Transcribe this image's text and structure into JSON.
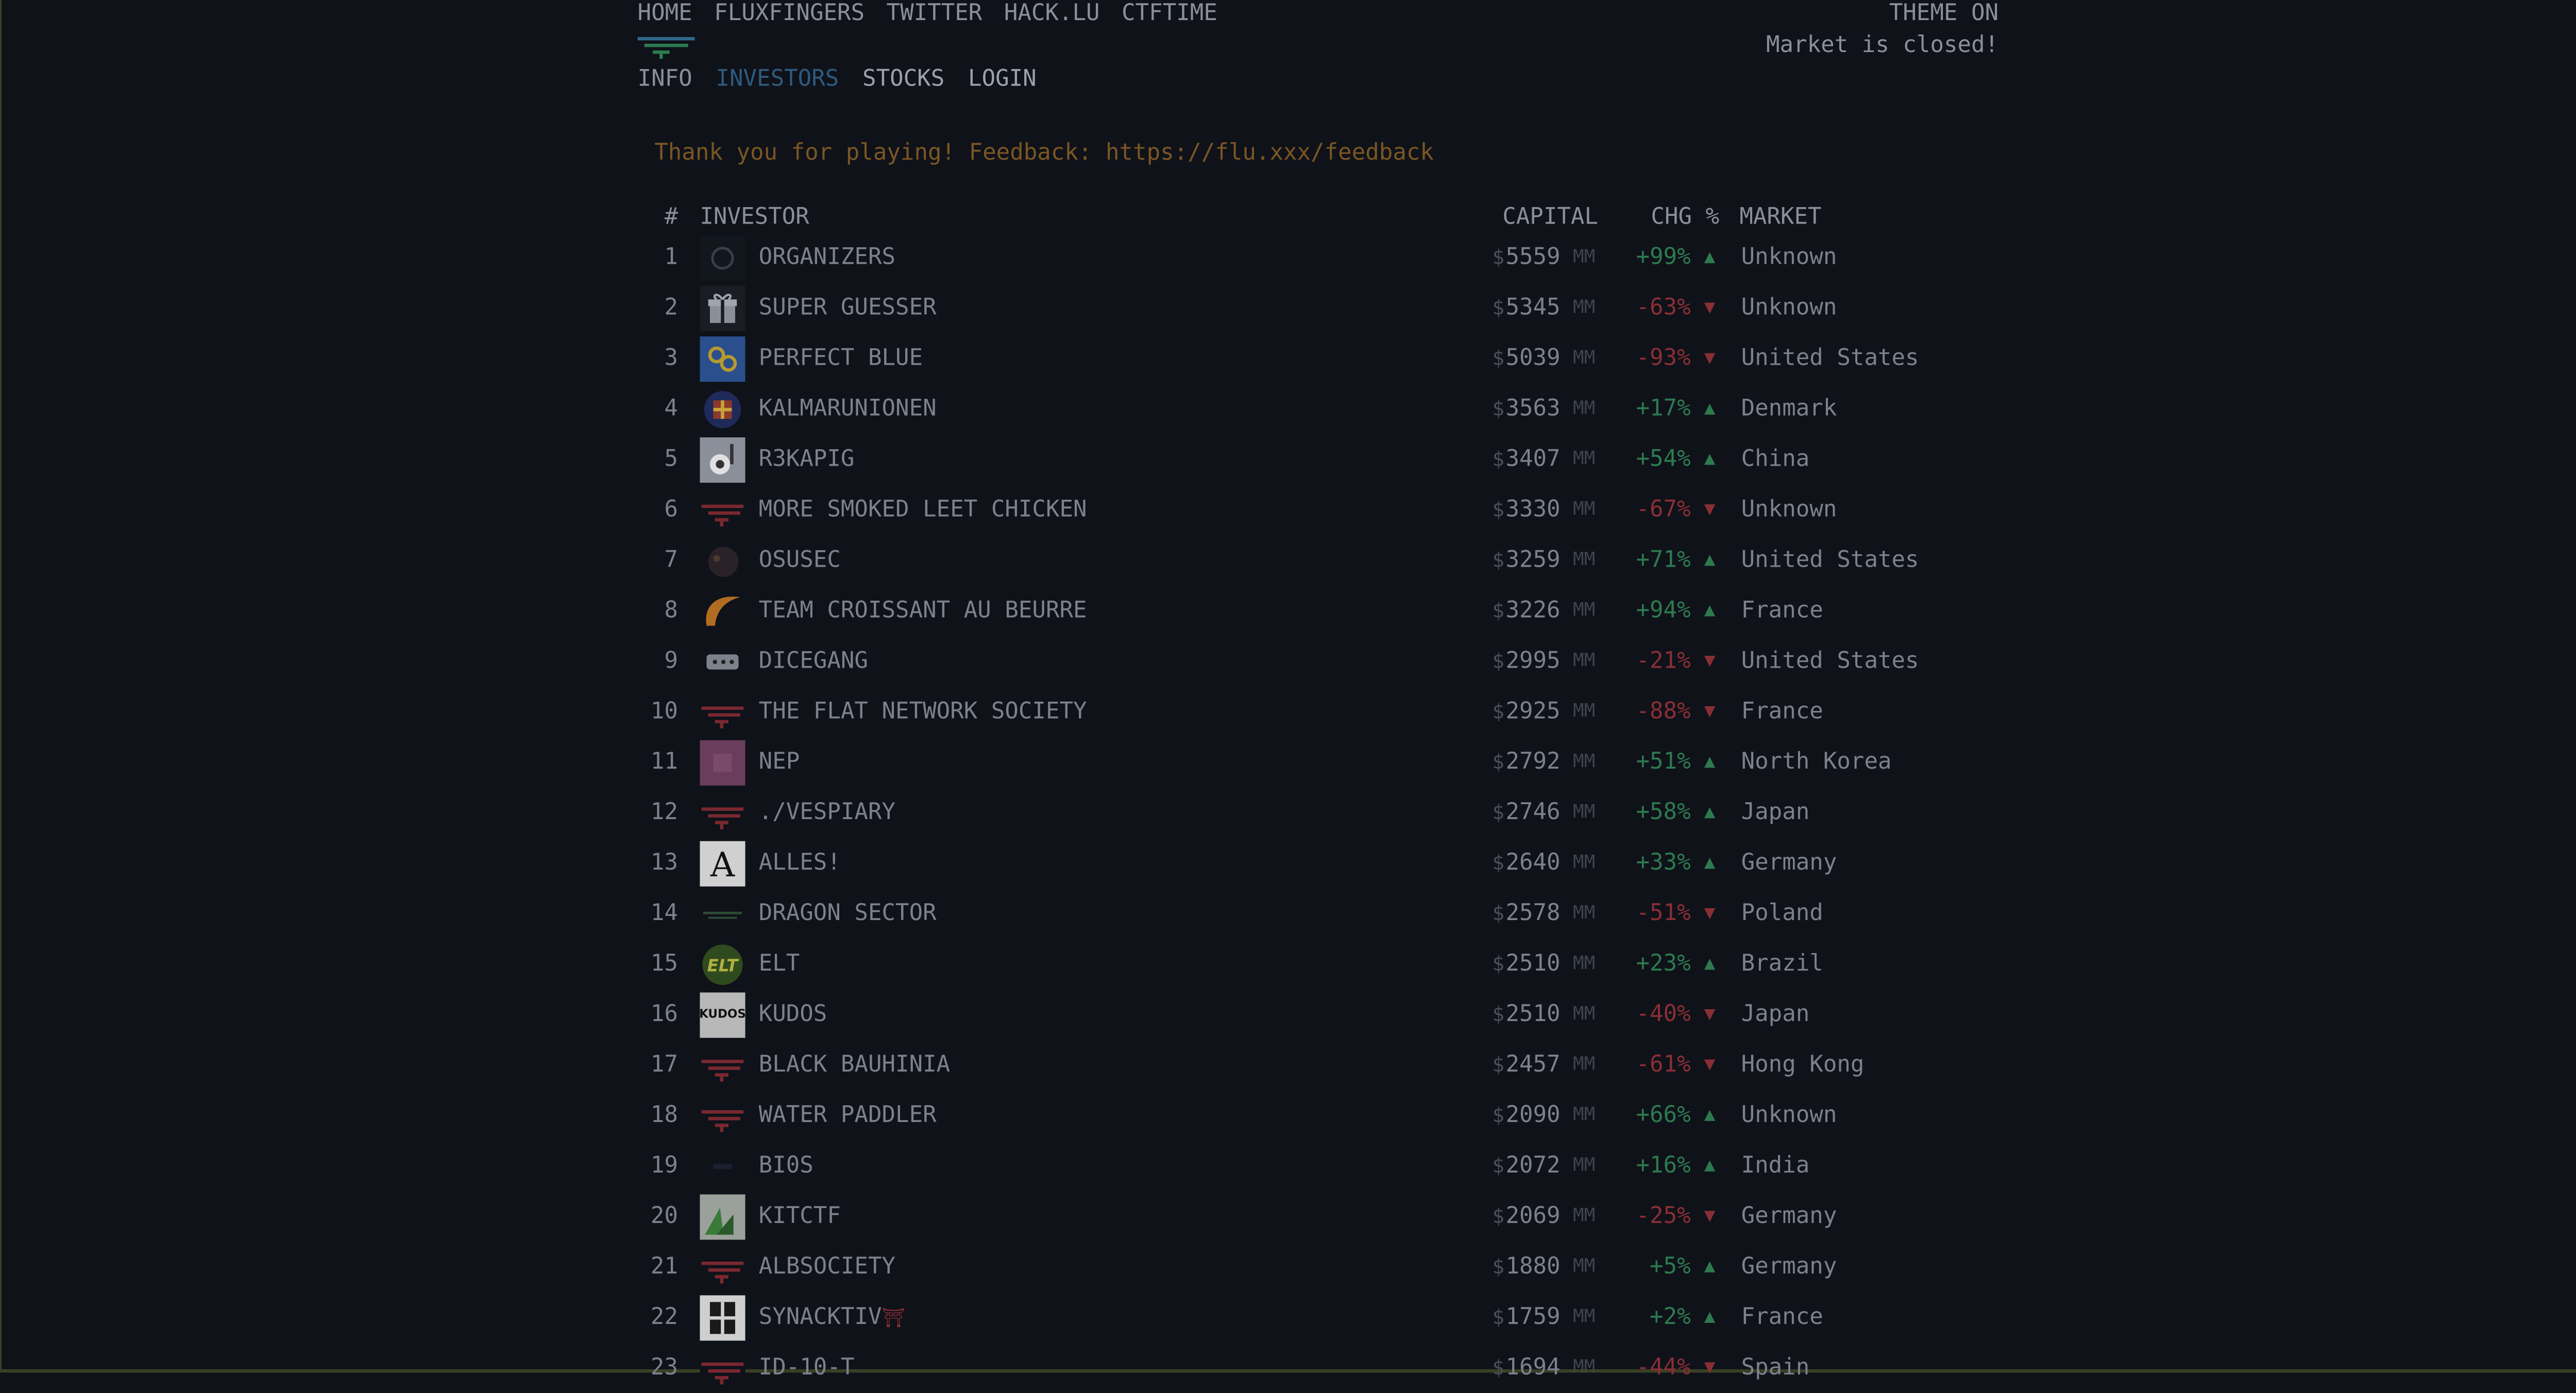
{
  "nav": {
    "top": [
      "HOME",
      "FLUXFINGERS",
      "TWITTER",
      "HACK.LU",
      "CTFTIME"
    ],
    "theme_label": "THEME ON",
    "market_status": "Market is closed!",
    "sub": [
      "INFO",
      "INVESTORS",
      "STOCKS",
      "LOGIN"
    ],
    "active": "INVESTORS"
  },
  "notice": "Thank you for playing! Feedback: https://flu.xxx/feedback",
  "table": {
    "headers": {
      "rank": "#",
      "investor": "INVESTOR",
      "capital": "CAPITAL",
      "chg": "CHG %",
      "market": "MARKET"
    },
    "currency_symbol": "$",
    "unit": "MM",
    "rows": [
      {
        "rank": "1",
        "name": "ORGANIZERS",
        "capital": "5559",
        "chg": "+99%",
        "dir": "up",
        "market": "Unknown",
        "avatar": "ring-icon"
      },
      {
        "rank": "2",
        "name": "SUPER GUESSER",
        "capital": "5345",
        "chg": "-63%",
        "dir": "down",
        "market": "Unknown",
        "avatar": "gift-icon"
      },
      {
        "rank": "3",
        "name": "PERFECT BLUE",
        "capital": "5039",
        "chg": "-93%",
        "dir": "down",
        "market": "United States",
        "avatar": "blue-emblem-icon"
      },
      {
        "rank": "4",
        "name": "KALMARUNIONEN",
        "capital": "3563",
        "chg": "+17%",
        "dir": "up",
        "market": "Denmark",
        "avatar": "crest-icon"
      },
      {
        "rank": "5",
        "name": "R3KAPIG",
        "capital": "3407",
        "chg": "+54%",
        "dir": "up",
        "market": "China",
        "avatar": "pig-icon"
      },
      {
        "rank": "6",
        "name": "MORE SMOKED LEET CHICKEN",
        "capital": "3330",
        "chg": "-67%",
        "dir": "down",
        "market": "Unknown",
        "avatar": "default-flag-icon"
      },
      {
        "rank": "7",
        "name": "OSUSEC",
        "capital": "3259",
        "chg": "+71%",
        "dir": "up",
        "market": "United States",
        "avatar": "beaver-icon"
      },
      {
        "rank": "8",
        "name": "TEAM CROISSANT AU BEURRE",
        "capital": "3226",
        "chg": "+94%",
        "dir": "up",
        "market": "France",
        "avatar": "croissant-icon"
      },
      {
        "rank": "9",
        "name": "DICEGANG",
        "capital": "2995",
        "chg": "-21%",
        "dir": "down",
        "market": "United States",
        "avatar": "dice-icon"
      },
      {
        "rank": "10",
        "name": "THE FLAT NETWORK SOCIETY",
        "capital": "2925",
        "chg": "-88%",
        "dir": "down",
        "market": "France",
        "avatar": "default-flag-icon"
      },
      {
        "rank": "11",
        "name": "NEP",
        "capital": "2792",
        "chg": "+51%",
        "dir": "up",
        "market": "North Korea",
        "avatar": "pink-square-icon"
      },
      {
        "rank": "12",
        "name": "./VESPIARY",
        "capital": "2746",
        "chg": "+58%",
        "dir": "up",
        "market": "Japan",
        "avatar": "default-flag-icon"
      },
      {
        "rank": "13",
        "name": "ALLES!",
        "capital": "2640",
        "chg": "+33%",
        "dir": "up",
        "market": "Germany",
        "avatar": "letter-a-icon"
      },
      {
        "rank": "14",
        "name": "DRAGON SECTOR",
        "capital": "2578",
        "chg": "-51%",
        "dir": "down",
        "market": "Poland",
        "avatar": "dragon-icon"
      },
      {
        "rank": "15",
        "name": "ELT",
        "capital": "2510",
        "chg": "+23%",
        "dir": "up",
        "market": "Brazil",
        "avatar": "elt-badge-icon"
      },
      {
        "rank": "16",
        "name": "KUDOS",
        "capital": "2510",
        "chg": "-40%",
        "dir": "down",
        "market": "Japan",
        "avatar": "kudos-icon"
      },
      {
        "rank": "17",
        "name": "BLACK BAUHINIA",
        "capital": "2457",
        "chg": "-61%",
        "dir": "down",
        "market": "Hong Kong",
        "avatar": "default-flag-icon"
      },
      {
        "rank": "18",
        "name": "WATER PADDLER",
        "capital": "2090",
        "chg": "+66%",
        "dir": "up",
        "market": "Unknown",
        "avatar": "default-flag-icon"
      },
      {
        "rank": "19",
        "name": "BI0S",
        "capital": "2072",
        "chg": "+16%",
        "dir": "up",
        "market": "India",
        "avatar": "bios-icon"
      },
      {
        "rank": "20",
        "name": "KITCTF",
        "capital": "2069",
        "chg": "-25%",
        "dir": "down",
        "market": "Germany",
        "avatar": "kit-icon"
      },
      {
        "rank": "21",
        "name": "ALBSOCIETY",
        "capital": "1880",
        "chg": "+5%",
        "dir": "up",
        "market": "Germany",
        "avatar": "default-flag-icon"
      },
      {
        "rank": "22",
        "name": "SYNACKTIV",
        "badge": "⛩",
        "capital": "1759",
        "chg": "+2%",
        "dir": "up",
        "market": "France",
        "avatar": "synacktiv-icon"
      },
      {
        "rank": "23",
        "name": "ID-10-T",
        "capital": "1694",
        "chg": "-44%",
        "dir": "down",
        "market": "Spain",
        "avatar": "default-flag-icon"
      }
    ]
  },
  "colors": {
    "background": "#0f1219",
    "text": "#7c818c",
    "active_link": "#2e5a7e",
    "notice": "#7a5623",
    "up": "#2d7a4f",
    "down": "#8a2e35"
  }
}
